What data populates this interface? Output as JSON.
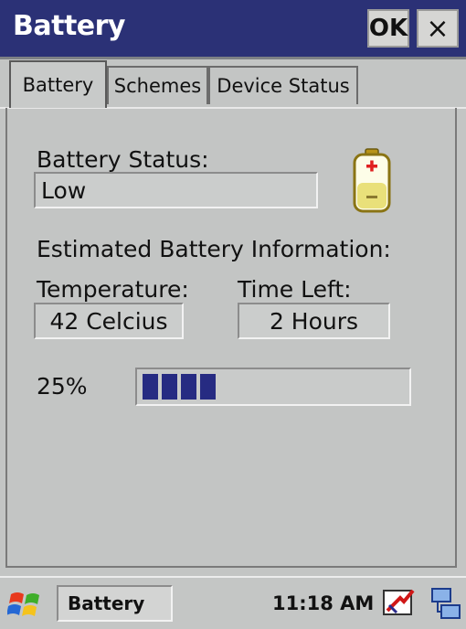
{
  "window": {
    "title": "Battery",
    "ok_label": "OK",
    "close_label": "×"
  },
  "tabs": [
    {
      "label": "Battery",
      "active": true
    },
    {
      "label": "Schemes",
      "active": false
    },
    {
      "label": "Device Status",
      "active": false
    }
  ],
  "battery_status": {
    "label": "Battery Status:",
    "value": "Low"
  },
  "estimated": {
    "heading": "Estimated Battery Information:",
    "temperature_label": "Temperature:",
    "temperature_value": "42 Celcius",
    "time_left_label": "Time Left:",
    "time_left_value": "2 Hours"
  },
  "charge": {
    "percent_label": "25%",
    "fraction": 0.25
  },
  "taskbar": {
    "app_label": "Battery",
    "clock": "11:18 AM"
  },
  "icons": {
    "battery": "battery-low-icon",
    "start": "windows-flag-icon",
    "power_tray": "power-plug-icon",
    "connectivity_tray": "connectivity-icon"
  },
  "colors": {
    "titlebar": "#2b3176",
    "progress_fill": "#262b82",
    "background": "#c3c5c4"
  }
}
